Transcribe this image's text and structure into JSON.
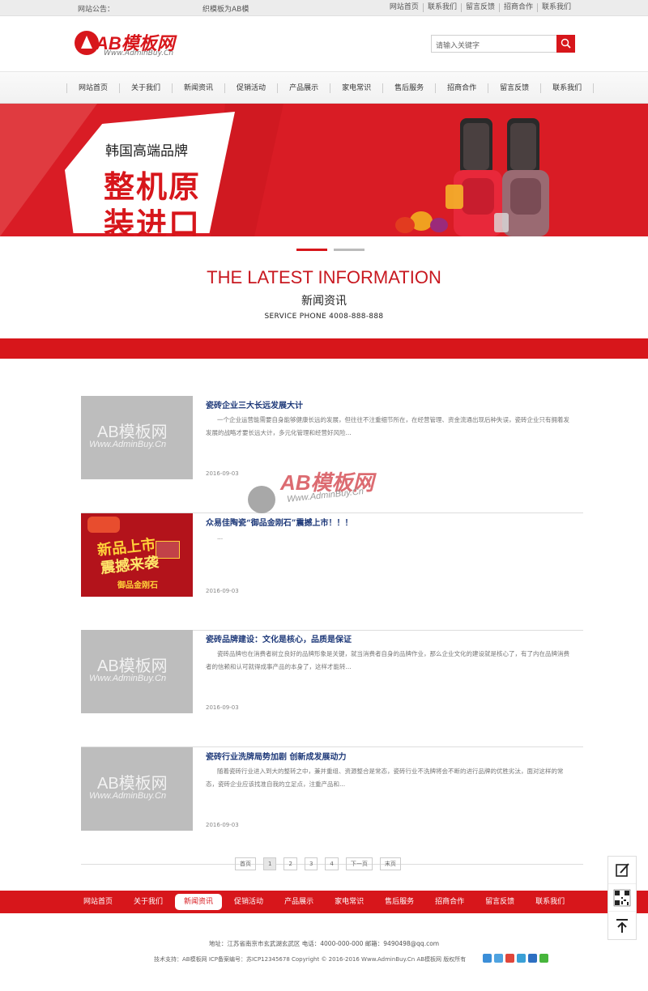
{
  "topbar": {
    "notice_label": "网站公告：",
    "notice_text": "织模板为AB模",
    "links": [
      "网站首页",
      "联系我们",
      "留言反馈",
      "招商合作",
      "联系我们"
    ]
  },
  "header": {
    "logo_text": "AB模板网",
    "logo_url": "Www.AdminBuy.Cn",
    "search_placeholder": "请输入关键字"
  },
  "nav": {
    "items": [
      "网站首页",
      "关于我们",
      "新闻资讯",
      "促销活动",
      "产品展示",
      "家电常识",
      "售后服务",
      "招商合作",
      "留言反馈",
      "联系我们"
    ]
  },
  "banner": {
    "sub": "韩国高端品牌",
    "line1": "整机原",
    "line2": "装进口",
    "slides_total": 2,
    "active_slide": 1
  },
  "section": {
    "title_en": "THE LATEST INFORMATION",
    "title_cn": "新闻资讯",
    "phone": "SERVICE PHONE 4008-888-888"
  },
  "news": [
    {
      "title": "瓷砖企业三大长远发展大计",
      "desc": "一个企业运营能需要自身能够健康长远的发展，但往往不注重细节所在，在经营管理、资金流通出现后种失误，瓷砖企业只有拥着发发展的战略才要长远大计，多元化管理和经营好风险...",
      "date": "2016-09-03",
      "thumb_wm1": "AB模板网",
      "thumb_wm2": "Www.AdminBuy.Cn"
    },
    {
      "title": "众易佳陶瓷“御品金刚石”震撼上市！！！",
      "desc": "...",
      "date": "2016-09-03",
      "promo1": "新品上市",
      "promo2": "震撼来袭",
      "promo3": "御品金刚石"
    },
    {
      "title": "瓷砖品牌建设：文化是核心，品质是保证",
      "desc": "瓷砖品牌也在消费者树立良好的品牌形象是关键，就当消费者自身的品牌作业，那么企业文化的建设就是核心了，有了内在品牌消费者的信赖和认可就得成事产品的本身了，这样才能转...",
      "date": "2016-09-03",
      "thumb_wm1": "AB模板网",
      "thumb_wm2": "Www.AdminBuy.Cn"
    },
    {
      "title": "瓷砖行业洗牌局势加剧 创新成发展动力",
      "desc": "随着瓷砖行业进入到大的整转之中，兼并重组、资源整合是常态，瓷砖行业不洗牌将会不断的进行品牌的优胜劣汰，面对这样的常态，瓷砖企业应该找准自我的立足点，注重产品和...",
      "date": "2016-09-03",
      "thumb_wm1": "AB模板网",
      "thumb_wm2": "Www.AdminBuy.Cn"
    }
  ],
  "watermark": {
    "text": "AB模板网",
    "url": "Www.AdminBuy.Cn"
  },
  "pager": [
    "首页",
    "1",
    "2",
    "3",
    "4",
    "下一页",
    "末页"
  ],
  "footer": {
    "nav": [
      "网站首页",
      "关于我们",
      "新闻资讯",
      "促销活动",
      "产品展示",
      "家电常识",
      "售后服务",
      "招商合作",
      "留言反馈",
      "联系我们"
    ],
    "active_index": 2,
    "address": "地址：江苏省南京市玄武湖玄武区  电话：4000-000-000  邮箱：9490498@qq.com",
    "copyright": "技术支持：AB模板网  ICP备案编号：苏ICP12345678  Copyright © 2016-2016 Www.AdminBuy.Cn AB模板网 版权所有"
  },
  "colors": {
    "brand": "#d7161b",
    "link_title": "#1f3a7a"
  },
  "icons": [
    "search-icon",
    "edit-icon",
    "qrcode-icon",
    "back-to-top-icon"
  ]
}
